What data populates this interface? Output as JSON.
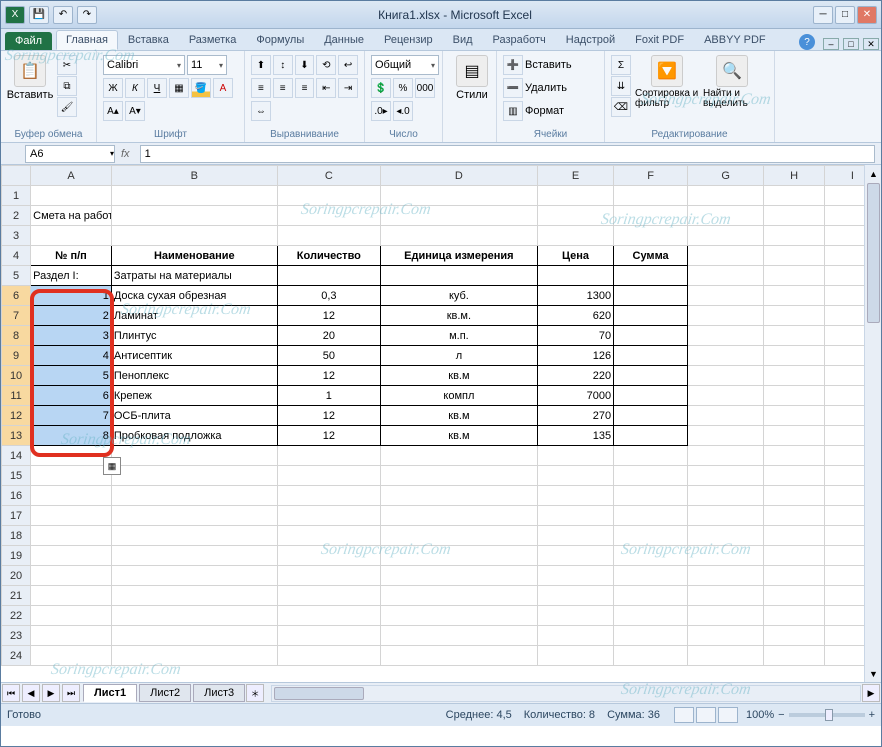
{
  "title": "Книга1.xlsx - Microsoft Excel",
  "tabs": {
    "file": "Файл",
    "home": "Главная",
    "insert": "Вставка",
    "layout": "Разметка",
    "formulas": "Формулы",
    "data": "Данные",
    "review": "Рецензир",
    "view": "Вид",
    "dev": "Разработч",
    "addins": "Надстрой",
    "foxit": "Foxit PDF",
    "abbyy": "ABBYY PDF"
  },
  "ribbon": {
    "clipboard": {
      "paste": "Вставить",
      "label": "Буфер обмена"
    },
    "font": {
      "name": "Calibri",
      "size": "11",
      "label": "Шрифт"
    },
    "align": {
      "label": "Выравнивание"
    },
    "number": {
      "fmt": "Общий",
      "label": "Число"
    },
    "styles": {
      "btn": "Стили",
      "label": ""
    },
    "cells": {
      "insert": "Вставить",
      "delete": "Удалить",
      "format": "Формат",
      "label": "Ячейки"
    },
    "editing": {
      "sort": "Сортировка и фильтр",
      "find": "Найти и выделить",
      "label": "Редактирование"
    }
  },
  "namebox": "A6",
  "formula": "1",
  "columns": [
    "A",
    "B",
    "C",
    "D",
    "E",
    "F",
    "G",
    "H",
    "I"
  ],
  "chart_data": {
    "type": "table",
    "title": "Смета на работы",
    "section": "Раздел I: Затраты на материалы",
    "headers": {
      "num": "№ п/п",
      "name": "Наименование",
      "qty": "Количество",
      "unit": "Единица измерения",
      "price": "Цена",
      "sum": "Сумма"
    },
    "rows": [
      {
        "num": 1,
        "name": "Доска сухая обрезная",
        "qty": "0,3",
        "unit": "куб.",
        "price": 1300,
        "sum": ""
      },
      {
        "num": 2,
        "name": "Ламинат",
        "qty": 12,
        "unit": "кв.м.",
        "price": 620,
        "sum": ""
      },
      {
        "num": 3,
        "name": "Плинтус",
        "qty": 20,
        "unit": "м.п.",
        "price": 70,
        "sum": ""
      },
      {
        "num": 4,
        "name": "Антисептик",
        "qty": 50,
        "unit": "л",
        "price": 126,
        "sum": ""
      },
      {
        "num": 5,
        "name": "Пеноплекс",
        "qty": 12,
        "unit": "кв.м",
        "price": 220,
        "sum": ""
      },
      {
        "num": 6,
        "name": "Крепеж",
        "qty": 1,
        "unit": "компл",
        "price": 7000,
        "sum": ""
      },
      {
        "num": 7,
        "name": "ОСБ-плита",
        "qty": 12,
        "unit": "кв.м",
        "price": 270,
        "sum": ""
      },
      {
        "num": 8,
        "name": "Пробковая подложка",
        "qty": 12,
        "unit": "кв.м",
        "price": 135,
        "sum": ""
      }
    ]
  },
  "sheets": {
    "s1": "Лист1",
    "s2": "Лист2",
    "s3": "Лист3"
  },
  "status": {
    "ready": "Готово",
    "avg": "Среднее: 4,5",
    "count": "Количество: 8",
    "sum": "Сумма: 36",
    "zoom": "100%"
  },
  "zoom": {
    "minus": "−",
    "plus": "+"
  },
  "watermark": "Soringpcrepair.Com"
}
